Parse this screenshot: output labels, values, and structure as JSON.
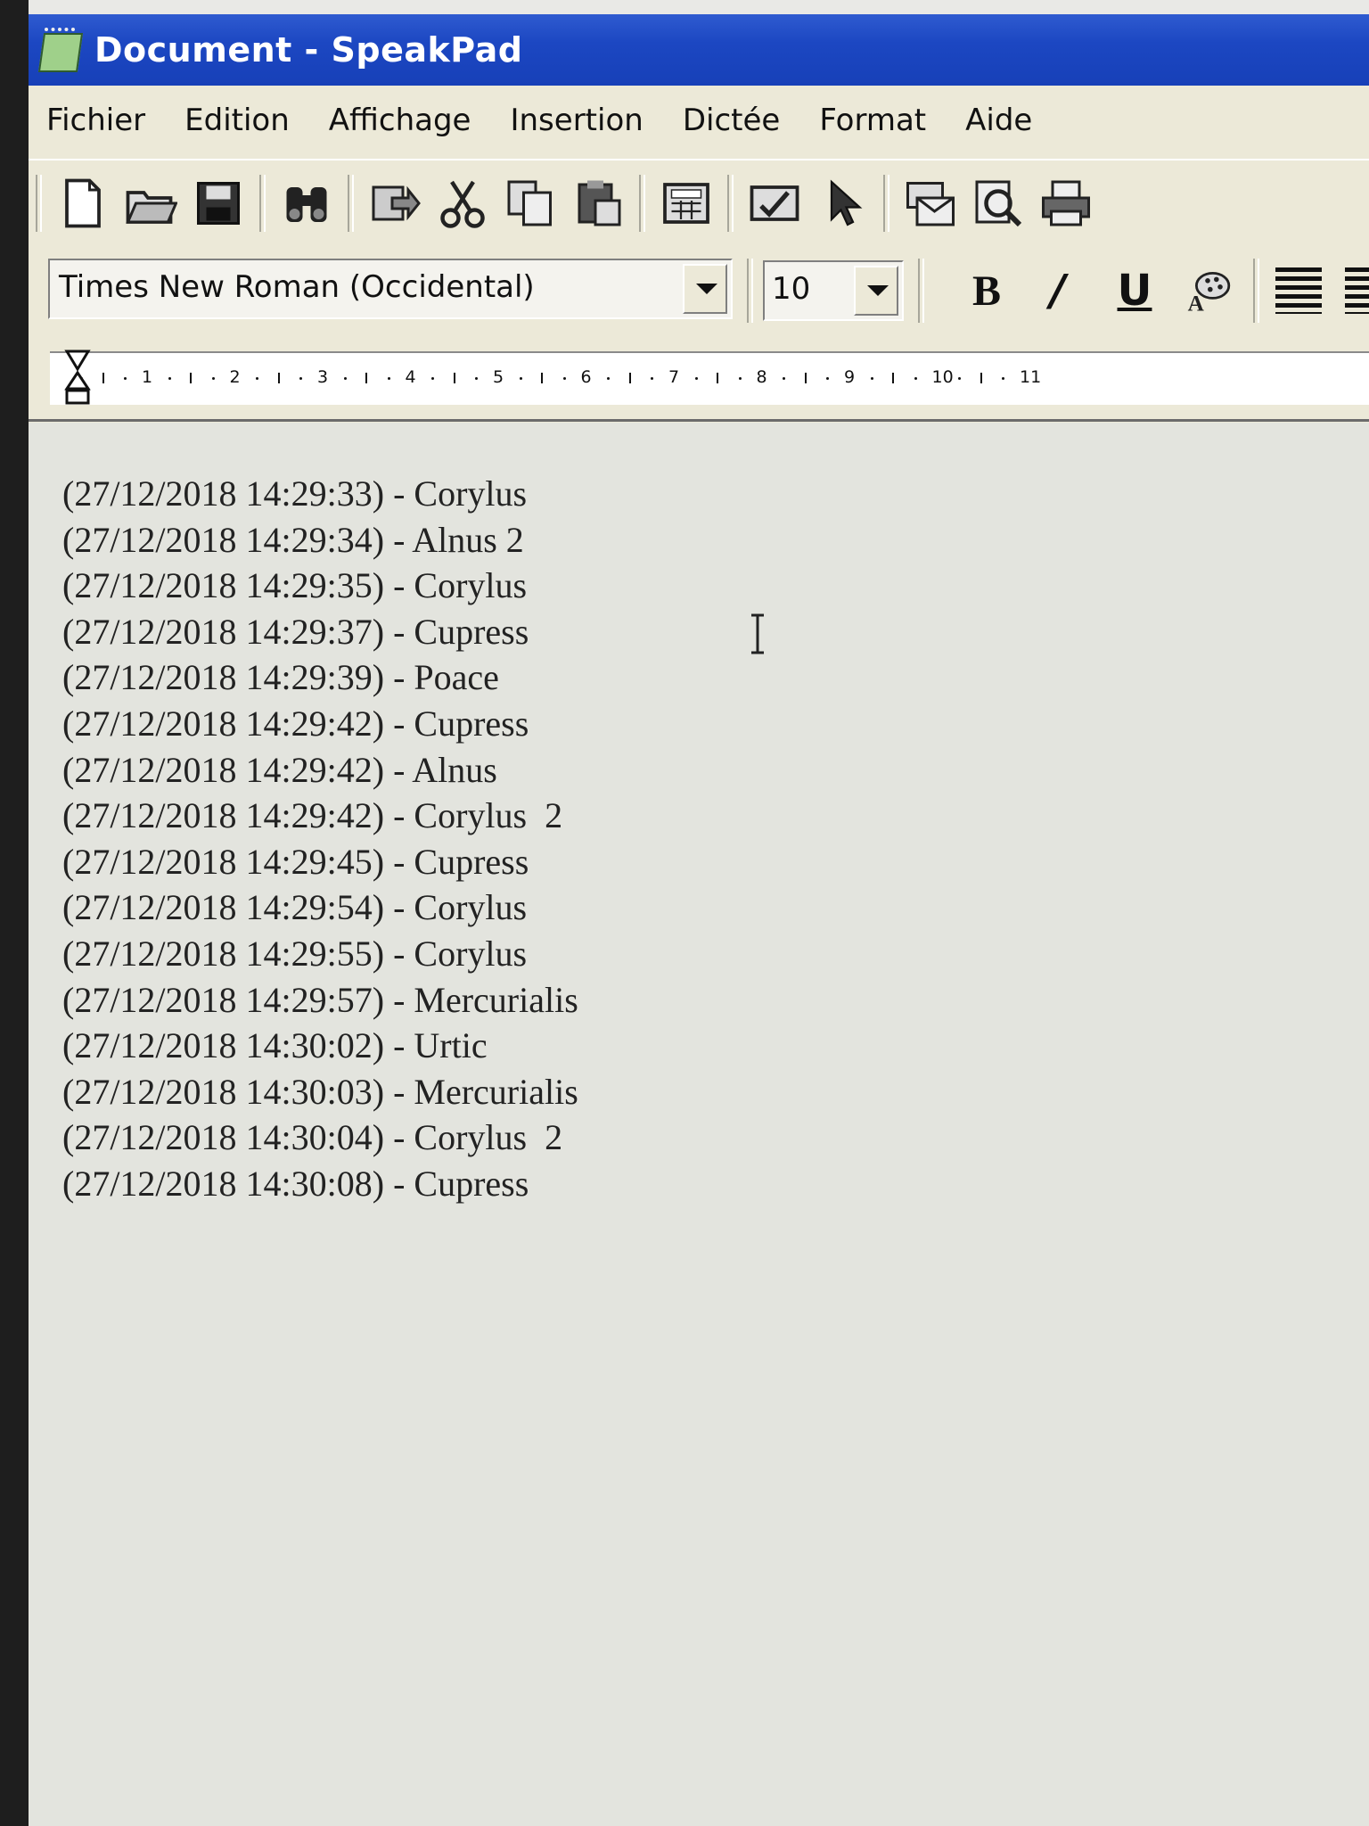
{
  "window": {
    "title": "Document - SpeakPad"
  },
  "menu": [
    "Fichier",
    "Edition",
    "Affichage",
    "Insertion",
    "Dictée",
    "Format",
    "Aide"
  ],
  "toolbar": {
    "icons": [
      "new-document-icon",
      "open-folder-icon",
      "save-icon",
      "find-icon",
      "export-icon",
      "cut-icon",
      "copy-icon",
      "paste-icon",
      "calculator-icon",
      "spellcheck-icon",
      "pointer-icon",
      "mail-icon",
      "print-preview-icon",
      "print-icon"
    ]
  },
  "format": {
    "font": "Times New Roman (Occidental)",
    "size": "10",
    "bold_label": "B",
    "italic_label": "/",
    "underline_label": "U"
  },
  "ruler": {
    "numbers": [
      "1",
      "2",
      "3",
      "4",
      "5",
      "6",
      "7",
      "8",
      "9",
      "10",
      "11"
    ]
  },
  "document": {
    "lines": [
      "(27/12/2018 14:29:33) - Corylus",
      "(27/12/2018 14:29:34) - Alnus 2",
      "(27/12/2018 14:29:35) - Corylus",
      "(27/12/2018 14:29:37) - Cupress",
      "(27/12/2018 14:29:39) - Poace",
      "(27/12/2018 14:29:42) - Cupress",
      "(27/12/2018 14:29:42) - Alnus",
      "(27/12/2018 14:29:42) - Corylus  2",
      "(27/12/2018 14:29:45) - Cupress",
      "(27/12/2018 14:29:54) - Corylus",
      "(27/12/2018 14:29:55) - Corylus",
      "(27/12/2018 14:29:57) - Mercurialis",
      "(27/12/2018 14:30:02) - Urtic",
      "(27/12/2018 14:30:03) - Mercurialis",
      "(27/12/2018 14:30:04) - Corylus  2",
      "(27/12/2018 14:30:08) - Cupress"
    ]
  },
  "colors": {
    "titlebar": "#1c47c2",
    "chrome": "#ece9d8",
    "document": "#e3e4de"
  }
}
